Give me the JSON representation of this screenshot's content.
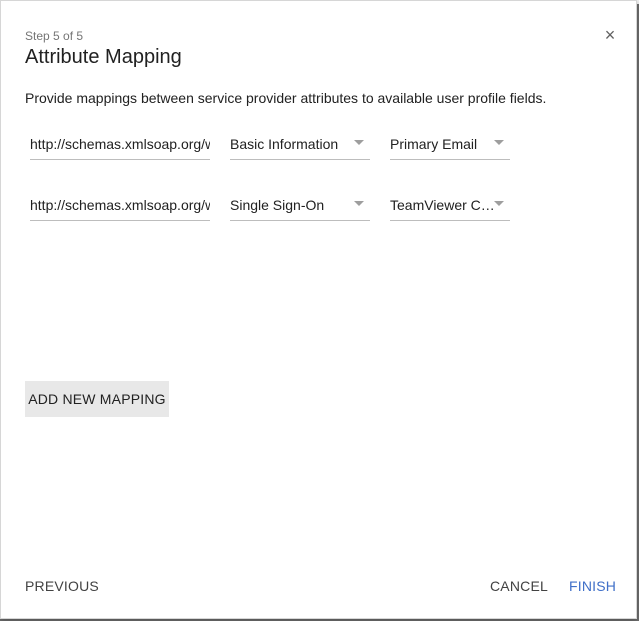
{
  "dialog": {
    "step": "Step 5 of 5",
    "title": "Attribute Mapping",
    "close_glyph": "×",
    "description": "Provide mappings between service provider attributes to available user profile fields."
  },
  "mappings": [
    {
      "attribute_uri": "http://schemas.xmlsoap.org/w",
      "category": "Basic Information",
      "user_field": "Primary Email"
    },
    {
      "attribute_uri": "http://schemas.xmlsoap.org/w",
      "category": "Single Sign-On",
      "user_field": "TeamViewer Cus..."
    }
  ],
  "actions": {
    "add_mapping": "ADD NEW MAPPING",
    "previous": "PREVIOUS",
    "cancel": "CANCEL",
    "finish": "FINISH"
  },
  "colors": {
    "accent": "#3f6fc8",
    "button_bg": "#e8e8e8",
    "underline": "#bdbdbd"
  }
}
